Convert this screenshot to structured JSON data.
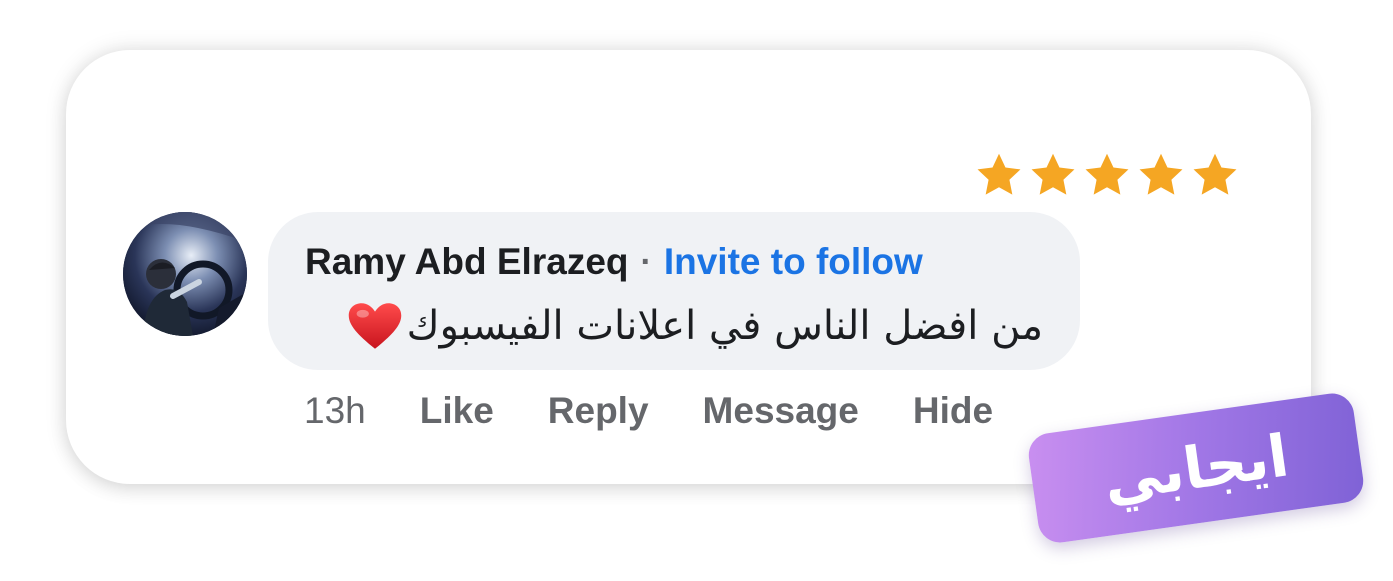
{
  "rating": {
    "stars": 5,
    "star_color": "#f5a623"
  },
  "comment": {
    "author": "Ramy Abd Elrazeq",
    "separator": "·",
    "invite_label": "Invite to follow",
    "text": "من افضل الناس في اعلانات الفيسبوك",
    "emoji": "red-heart-icon",
    "bubble_color": "#f0f2f5",
    "link_color": "#1b74e4"
  },
  "actions": {
    "time": "13h",
    "like": "Like",
    "reply": "Reply",
    "message": "Message",
    "hide": "Hide"
  },
  "badge": {
    "label": "ايجابي",
    "gradient_start": "#c98ff0",
    "gradient_end": "#7f62d6"
  }
}
